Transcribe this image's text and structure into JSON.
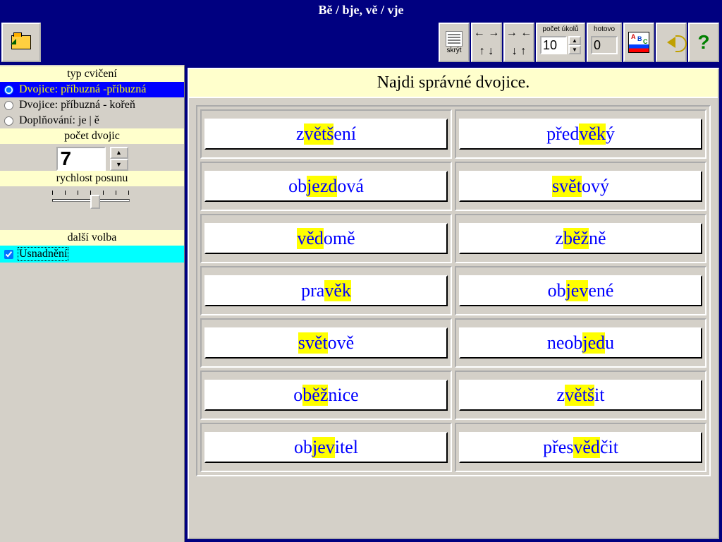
{
  "title": "Bě / bje,  vě / vje",
  "toolbar": {
    "skryt_label": "skrýt",
    "pocet_ukolu_label": "počet úkolů",
    "pocet_ukolu_value": "10",
    "hotovo_label": "hotovo",
    "hotovo_value": "0"
  },
  "sidebar": {
    "typ_cviceni_hdr": "typ cvičení",
    "radios": [
      {
        "label": "Dvojice: příbuzná -příbuzná",
        "selected": true
      },
      {
        "label": "Dvojice: příbuzná - kořeň",
        "selected": false
      },
      {
        "label": "Doplňování:  je | ě",
        "selected": false
      }
    ],
    "pocet_dvojic_hdr": "počet dvojic",
    "pocet_dvojic_value": "7",
    "rychlost_hdr": "rychlost posunu",
    "dalsi_volba_hdr": "další volba",
    "usnadneni_label": "Usnadnění",
    "usnadneni_checked": true
  },
  "main": {
    "instruction": "Najdi správné dvojice.",
    "cards": [
      {
        "pre": "z",
        "hl": "větš",
        "post": "ení"
      },
      {
        "pre": "před",
        "hl": "věk",
        "post": "ý"
      },
      {
        "pre": "ob",
        "hl": "jezd",
        "post": "ová"
      },
      {
        "pre": "",
        "hl": "svět",
        "post": "ový"
      },
      {
        "pre": "",
        "hl": "věd",
        "post": "omě"
      },
      {
        "pre": "z",
        "hl": "běž",
        "post": "ně"
      },
      {
        "pre": "pra",
        "hl": "věk",
        "post": ""
      },
      {
        "pre": "ob",
        "hl": "jev",
        "post": "ené"
      },
      {
        "pre": "",
        "hl": "svět",
        "post": "ově"
      },
      {
        "pre": "neob",
        "hl": "jed",
        "post": "u"
      },
      {
        "pre": "o",
        "hl": "běž",
        "post": "nice"
      },
      {
        "pre": "z",
        "hl": "větš",
        "post": "it"
      },
      {
        "pre": "ob",
        "hl": "jev",
        "post": "itel"
      },
      {
        "pre": "přes",
        "hl": "věd",
        "post": "čit"
      }
    ]
  }
}
